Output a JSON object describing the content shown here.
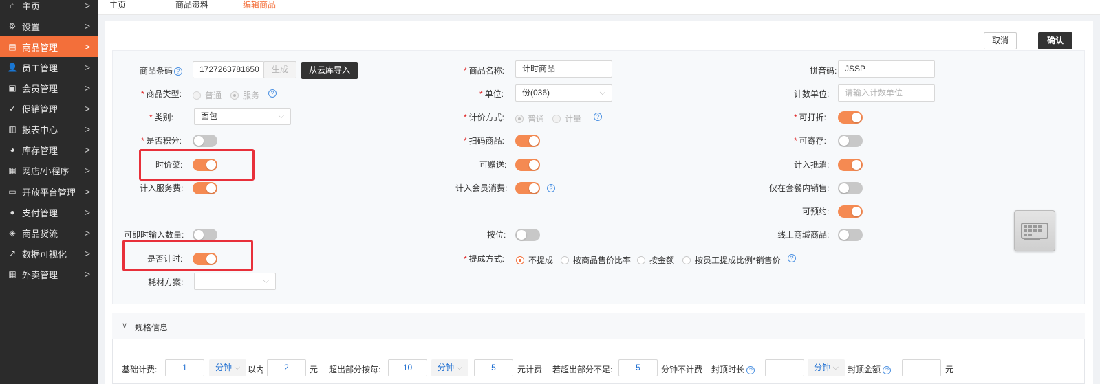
{
  "sidebar": {
    "items": [
      {
        "label": "主页",
        "icon": "home-icon",
        "glyph": "⌂"
      },
      {
        "label": "设置",
        "icon": "gear-icon",
        "glyph": "⚙"
      },
      {
        "label": "商品管理",
        "icon": "list-icon",
        "glyph": "▤"
      },
      {
        "label": "员工管理",
        "icon": "user-icon",
        "glyph": "👤"
      },
      {
        "label": "会员管理",
        "icon": "member-card-icon",
        "glyph": "▣"
      },
      {
        "label": "促销管理",
        "icon": "check-circle-icon",
        "glyph": "✓"
      },
      {
        "label": "报表中心",
        "icon": "bar-chart-icon",
        "glyph": "▥"
      },
      {
        "label": "库存管理",
        "icon": "pie-chart-icon",
        "glyph": "◕"
      },
      {
        "label": "网店/小程序",
        "icon": "store-icon",
        "glyph": "▦"
      },
      {
        "label": "开放平台管理",
        "icon": "monitor-icon",
        "glyph": "▭"
      },
      {
        "label": "支付管理",
        "icon": "coin-icon",
        "glyph": "●"
      },
      {
        "label": "商品货流",
        "icon": "cube-icon",
        "glyph": "◈"
      },
      {
        "label": "数据可视化",
        "icon": "line-chart-icon",
        "glyph": "↗"
      },
      {
        "label": "外卖管理",
        "icon": "takeout-icon",
        "glyph": "▦"
      }
    ],
    "active_index": 2,
    "arrow": ">"
  },
  "tabs": [
    "主页",
    "商品资料",
    "编辑商品"
  ],
  "actions": {
    "cancel": "取消",
    "confirm": "确认"
  },
  "form": {
    "barcode": {
      "label": "商品条码",
      "value": "1727263781650",
      "generate": "生成",
      "import_button": "从云库导入"
    },
    "name": {
      "label": "商品名称:",
      "value": "计时商品"
    },
    "pinyin": {
      "label": "拼音码:",
      "value": "JSSP"
    },
    "product_type": {
      "label": "商品类型:",
      "options": [
        "普通",
        "服务"
      ],
      "selected": "服务"
    },
    "unit": {
      "label": "单位:",
      "value": "份(036)"
    },
    "count_unit": {
      "label": "计数单位:",
      "placeholder": "请输入计数单位"
    },
    "category": {
      "label": "类别:",
      "value": "面包"
    },
    "pricing_method": {
      "label": "计价方式:",
      "options": [
        "普通",
        "计量"
      ],
      "selected": "普通"
    },
    "discountable": {
      "label": "可打折:",
      "on": true
    },
    "points": {
      "label": "是否积分:",
      "on": false
    },
    "scan_item": {
      "label": "扫码商品:",
      "on": true
    },
    "storable": {
      "label": "可寄存:",
      "on": false
    },
    "market_price": {
      "label": "时价菜:",
      "on": true
    },
    "giftable": {
      "label": "可赠送:",
      "on": true
    },
    "count_offset": {
      "label": "计入抵消:",
      "on": true
    },
    "service_fee": {
      "label": "计入服务费:",
      "on": true
    },
    "member_spend": {
      "label": "计入会员消费:",
      "on": true
    },
    "combo_only": {
      "label": "仅在套餐内销售:",
      "on": false
    },
    "reservable": {
      "label": "可预约:",
      "on": true
    },
    "instant_qty": {
      "label": "可即时输入数量:",
      "on": false
    },
    "by_seat": {
      "label": "按位:",
      "on": false
    },
    "online_mall": {
      "label": "线上商城商品:",
      "on": false
    },
    "timed": {
      "label": "是否计时:",
      "on": true
    },
    "commission": {
      "label": "提成方式:",
      "options": [
        "不提成",
        "按商品售价比率",
        "按金额",
        "按员工提成比例*销售价"
      ],
      "selected": "不提成"
    },
    "material_plan": {
      "label": "耗材方案:",
      "value": ""
    }
  },
  "spec": {
    "title": "规格信息",
    "base_fee_label": "基础计费:",
    "base_value": "1",
    "base_unit": "分钟",
    "within": "以内",
    "base_price": "2",
    "yuan": "元",
    "excess_label": "超出部分按每:",
    "excess_value": "10",
    "excess_unit": "分钟",
    "excess_price": "5",
    "yuan_charge": "元计费",
    "less_label": "若超出部分不足:",
    "less_value": "5",
    "less_suffix": "分钟不计费",
    "cap_duration_label": "封顶时长",
    "cap_duration_value": "",
    "cap_unit": "分钟",
    "cap_amount_label": "封顶金额",
    "cap_amount_value": "",
    "cap_yuan": "元"
  },
  "colors": {
    "accent": "#f36f3a",
    "toggle_on": "#f58a52",
    "highlight": "#e8303a",
    "dark_button": "#333333"
  }
}
